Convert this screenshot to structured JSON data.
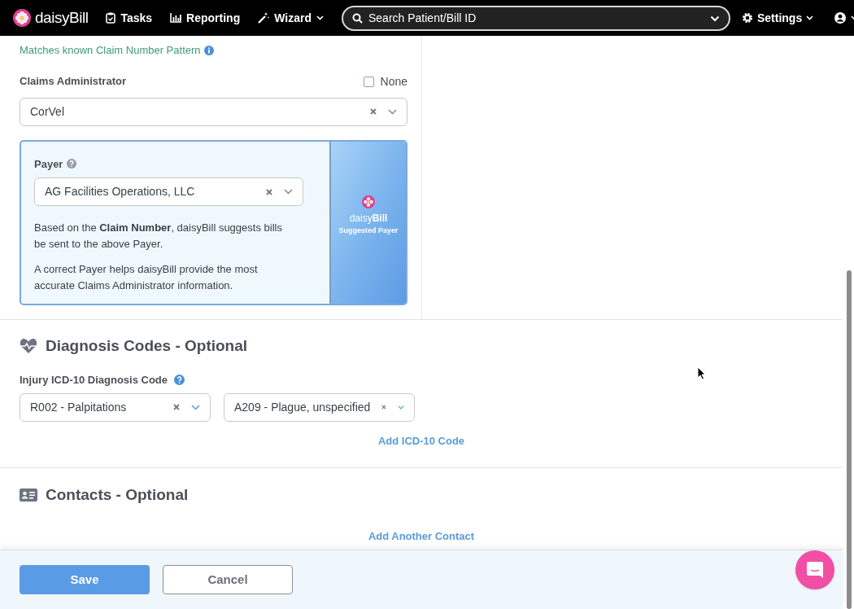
{
  "navbar": {
    "brand": "daisy**Bill**",
    "items": [
      {
        "kind": "tasks",
        "label": "Tasks",
        "dropdown": false
      },
      {
        "kind": "reporting",
        "label": "Reporting",
        "dropdown": false
      },
      {
        "kind": "wizard",
        "label": "Wizard",
        "dropdown": true
      }
    ],
    "search": {
      "placeholder": "Search Patient/Bill ID"
    },
    "settings": {
      "label": "Settings"
    }
  },
  "claim_pattern_note": "Matches known Claim Number Pattern",
  "claims_administrator": {
    "label": "Claims Administrator",
    "none_checkbox": {
      "label": "None",
      "checked": false
    },
    "value": "CorVel"
  },
  "payer_card": {
    "label": "Payer",
    "value": "AG Facilities Operations, LLC",
    "paragraphs": [
      "Based on the **Claim Number**, daisyBill suggests bills be sent to the above Payer.",
      "A correct Payer helps daisyBill provide the most accurate Claims Administrator information."
    ],
    "badge": {
      "brand": "daisy**Bill**",
      "caption": "Suggested Payer"
    }
  },
  "diagnosis": {
    "title": "Diagnosis Codes - Optional",
    "field_label": "Injury ICD-10 Diagnosis Code",
    "codes": [
      "R002 - Palpitations",
      "A209 - Plague, unspecified"
    ],
    "add_link": "Add ICD-10 Code"
  },
  "contacts": {
    "title": "Contacts - Optional",
    "add_link": "Add Another Contact"
  },
  "footer": {
    "save": "Save",
    "cancel": "Cancel"
  }
}
